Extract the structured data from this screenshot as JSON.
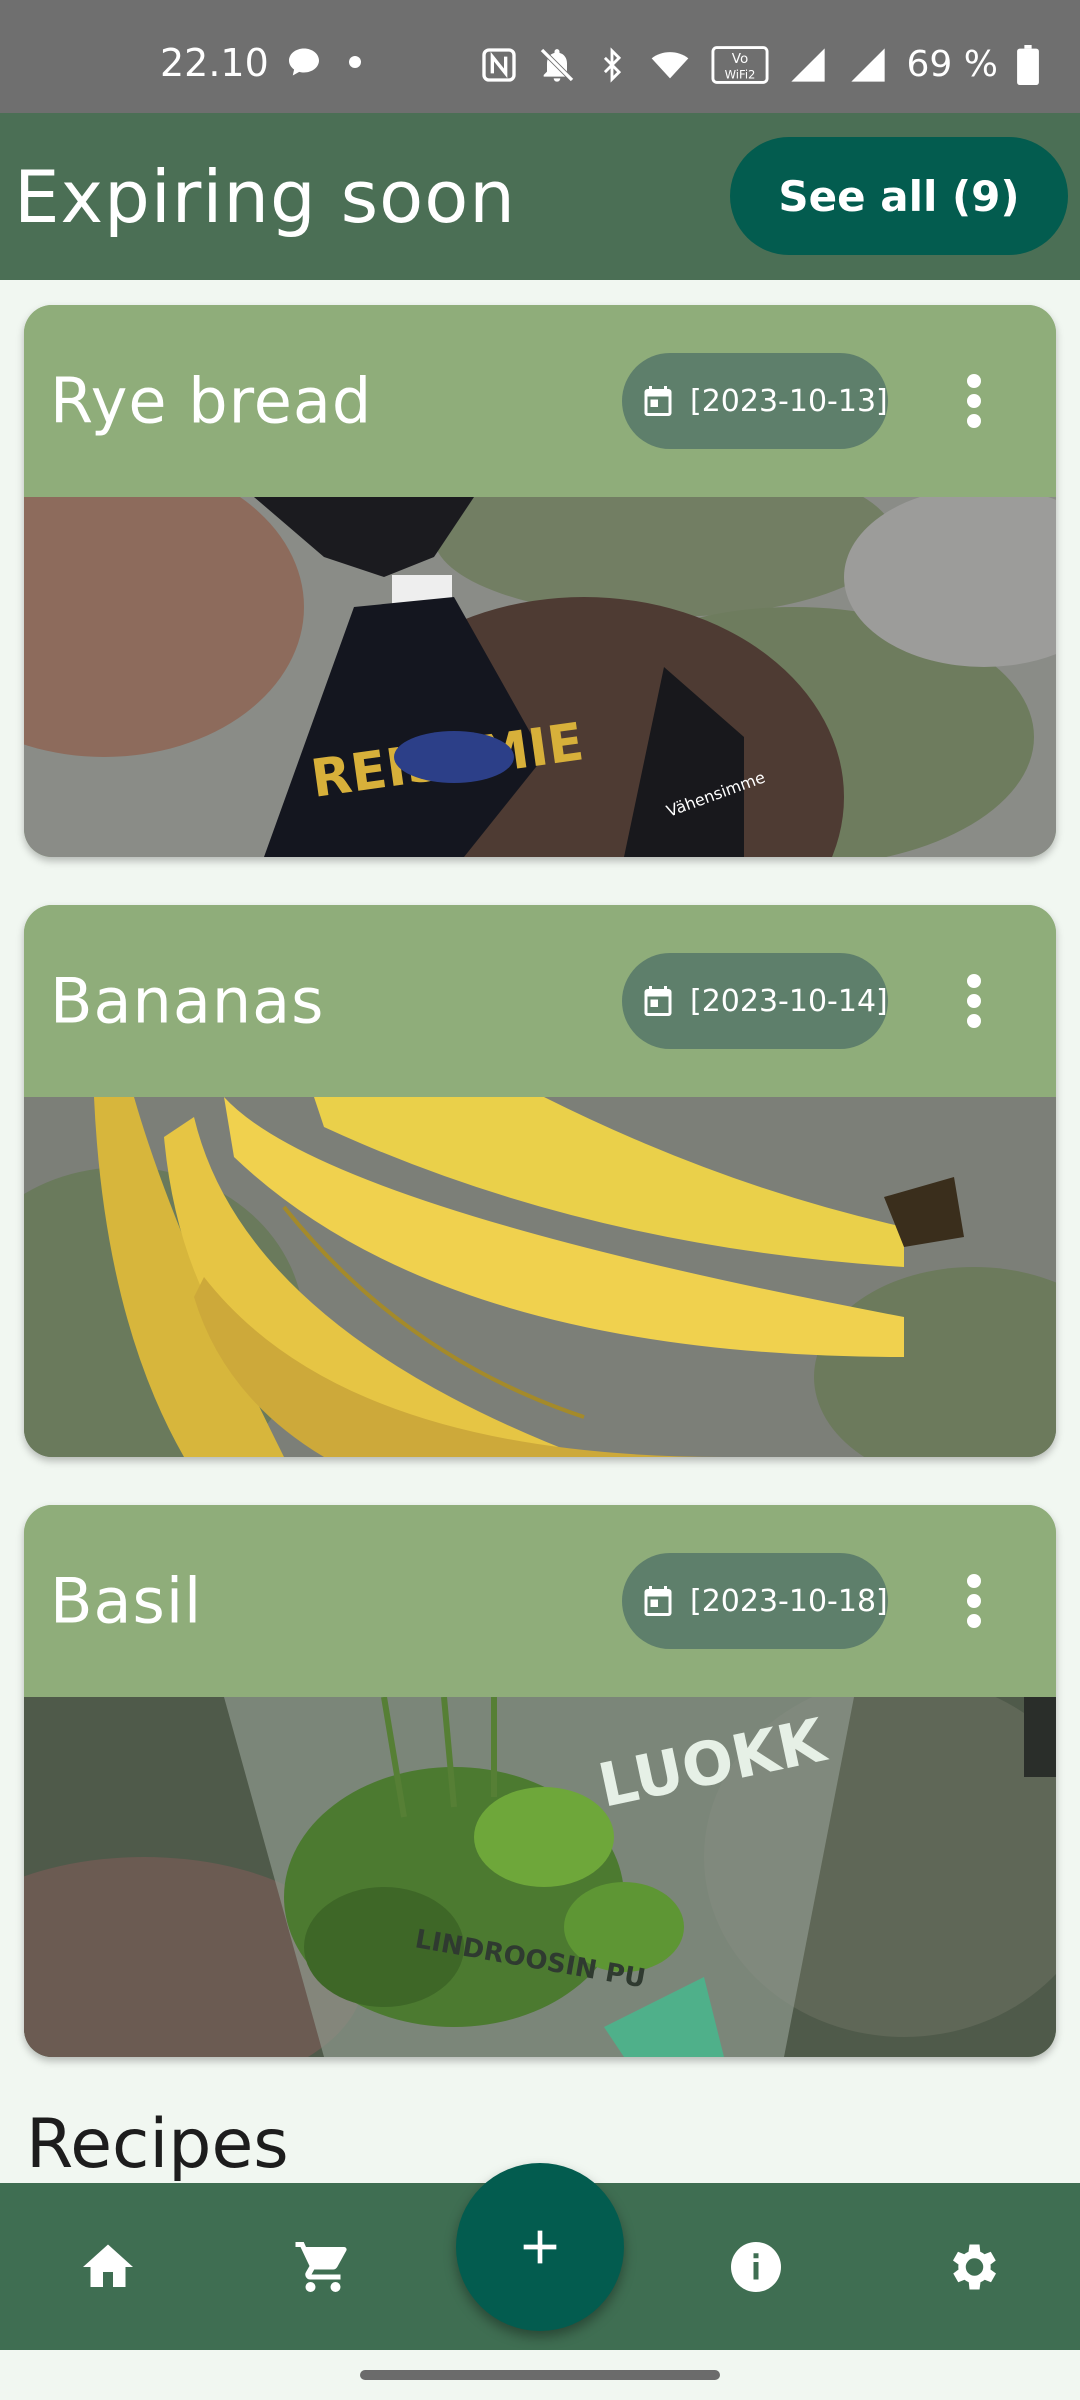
{
  "status_bar": {
    "time": "22.10",
    "battery": "69 %",
    "wifi_label": "VoWiFi2"
  },
  "header": {
    "title": "Expiring soon",
    "see_all_label": "See all (9)"
  },
  "items": [
    {
      "name": "Rye bread",
      "date": "[2023-10-13]",
      "image": "rye-bread-photo"
    },
    {
      "name": "Bananas",
      "date": "[2023-10-14]",
      "image": "bananas-photo"
    },
    {
      "name": "Basil",
      "date": "[2023-10-18]",
      "image": "basil-photo"
    }
  ],
  "sections": {
    "recipes_title": "Recipes"
  },
  "bottom_nav": {
    "items": [
      "home-icon",
      "cart-icon",
      "add-icon",
      "info-icon",
      "settings-icon"
    ]
  },
  "colors": {
    "header": "#4b6f55",
    "card": "#8fad7a",
    "chip": "#5e7f6b",
    "accent": "#035c4f",
    "nav": "#3f6e52"
  }
}
